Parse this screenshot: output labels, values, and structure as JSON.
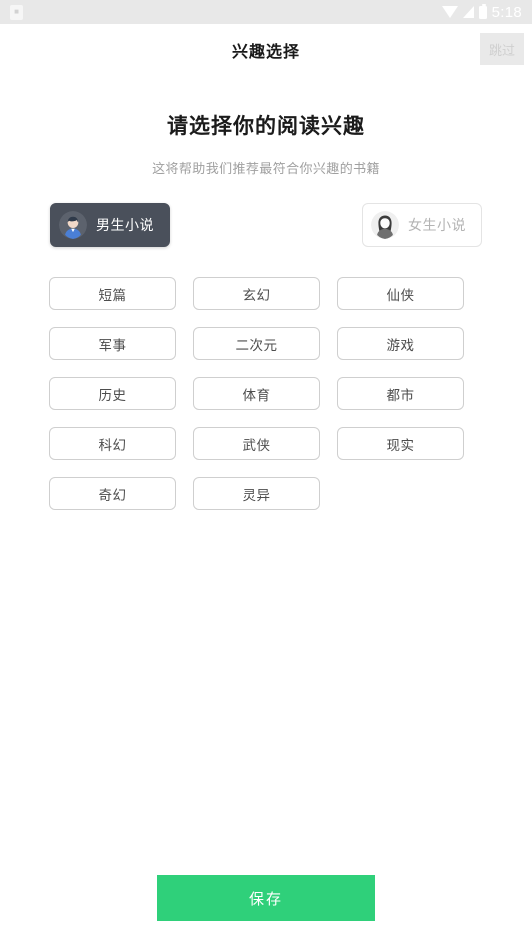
{
  "status_bar": {
    "notification_icon": "app-notification-icon",
    "wifi_icon": "wifi-icon",
    "signal_icon": "signal-icon",
    "battery_icon": "battery-icon",
    "time": "5:18",
    "background_color": "#e8e8e8"
  },
  "header": {
    "title": "兴趣选择",
    "skip_label": "跳过"
  },
  "intro": {
    "title": "请选择你的阅读兴趣",
    "subtitle": "这将帮助我们推荐最符合你兴趣的书籍"
  },
  "gender": {
    "options": [
      {
        "label": "男生小说",
        "icon": "male-avatar-icon",
        "selected": true
      },
      {
        "label": "女生小说",
        "icon": "female-avatar-icon",
        "selected": false
      }
    ],
    "selected_color": "#4a505b"
  },
  "categories": [
    {
      "label": "短篇",
      "selected": false
    },
    {
      "label": "玄幻",
      "selected": false
    },
    {
      "label": "仙侠",
      "selected": false
    },
    {
      "label": "军事",
      "selected": false
    },
    {
      "label": "二次元",
      "selected": false
    },
    {
      "label": "游戏",
      "selected": false
    },
    {
      "label": "历史",
      "selected": false
    },
    {
      "label": "体育",
      "selected": false
    },
    {
      "label": "都市",
      "selected": false
    },
    {
      "label": "科幻",
      "selected": false
    },
    {
      "label": "武侠",
      "selected": false
    },
    {
      "label": "现实",
      "selected": false
    },
    {
      "label": "奇幻",
      "selected": false
    },
    {
      "label": "灵异",
      "selected": false
    }
  ],
  "footer": {
    "save_label": "保存",
    "save_color": "#2fd07a"
  }
}
